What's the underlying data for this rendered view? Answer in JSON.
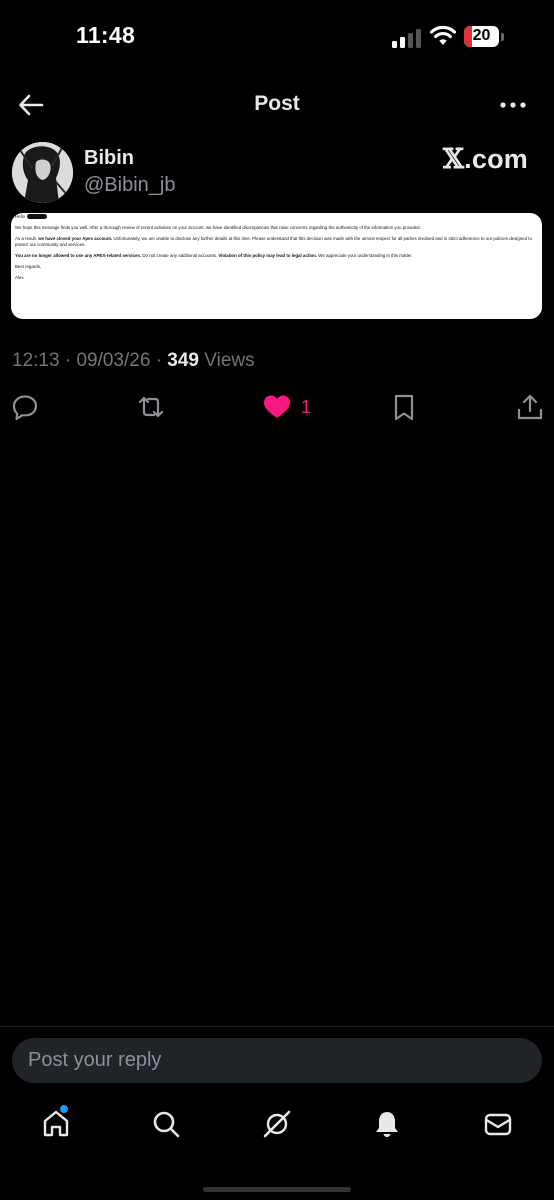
{
  "status_bar": {
    "time": "11:48",
    "battery_level": "20",
    "icons": [
      "cellular-signal-icon",
      "wifi-icon",
      "battery-icon"
    ]
  },
  "header": {
    "title": "Post",
    "back_icon": "arrow-left-icon",
    "more_icon": "ellipsis-icon"
  },
  "post": {
    "author_name": "Bibin",
    "author_handle": "@Bibin_jb",
    "brand_mark": "𝕏",
    "brand_suffix": ".com",
    "attachment": {
      "greeting": "Hello",
      "para1": "We hope this message finds you well. After a thorough review of recent activities on your account, we have identified discrepancies that raise concerns regarding the authenticity of the information you provided.",
      "para2_prefix": "As a result,",
      "para2_bold": "we have closed your Apex account.",
      "para2_rest": "Unfortunately, we are unable to disclose any further details at this time. Please understand that this decision was made with the utmost respect for all parties involved and in strict adherence to our policies designed to protect our community and services.",
      "para3_bold": "You are no longer allowed to use any APEX-related services.",
      "para3_mid": "Do not create any additional accounts.",
      "para3_bold2": "Violation of this policy may lead to legal action.",
      "para3_rest": "We appreciate your understanding in this matter.",
      "closing": "Best regards,",
      "signature": "Alex"
    },
    "time": "12:13",
    "date": "09/03/26",
    "separator": "·",
    "views_count": "349",
    "views_label": "Views",
    "like_count": "1"
  },
  "actions": {
    "icons": [
      "reply-icon",
      "repost-icon",
      "like-icon",
      "bookmark-icon",
      "share-icon"
    ],
    "like_color": "#f91880"
  },
  "reply": {
    "placeholder": "Post your reply"
  },
  "tabbar": {
    "icons": [
      "home-icon",
      "search-icon",
      "grok-icon",
      "notifications-icon",
      "messages-icon"
    ],
    "accent": "#1d9bf0"
  }
}
